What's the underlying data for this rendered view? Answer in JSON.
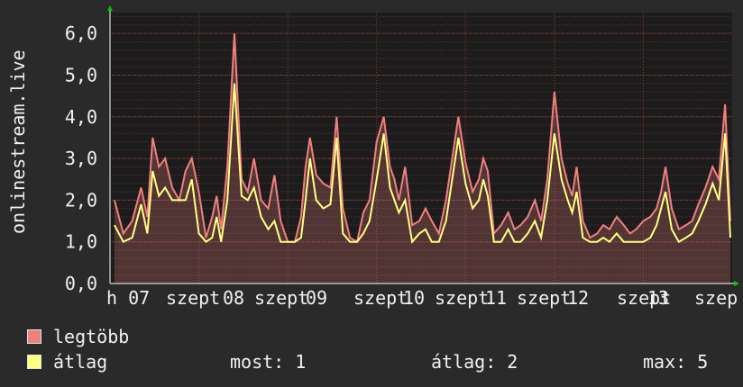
{
  "chart_data": {
    "type": "area",
    "ylabel": "onlinestream.live",
    "ylim": [
      0,
      6.5
    ],
    "yticks": [
      "0,0",
      "1,0",
      "2,0",
      "3,0",
      "4,0",
      "5,0",
      "6,0"
    ],
    "ytick_values": [
      0,
      1,
      2,
      3,
      4,
      5,
      6
    ],
    "xticks": [
      "h 07",
      "szept",
      "08",
      "szept",
      "09",
      "szept",
      "10",
      "szept",
      "11",
      "szept",
      "12",
      "szept",
      "13",
      "szep"
    ],
    "xlim": [
      0,
      7
    ],
    "grid": true,
    "series": [
      {
        "name": "legtöbb",
        "color": "#f07f7f",
        "x": [
          0.05,
          0.15,
          0.25,
          0.35,
          0.42,
          0.48,
          0.55,
          0.62,
          0.7,
          0.78,
          0.85,
          0.92,
          1.0,
          1.08,
          1.15,
          1.2,
          1.25,
          1.32,
          1.4,
          1.48,
          1.55,
          1.62,
          1.7,
          1.78,
          1.85,
          1.92,
          2.0,
          2.08,
          2.15,
          2.2,
          2.25,
          2.32,
          2.4,
          2.48,
          2.55,
          2.62,
          2.7,
          2.78,
          2.85,
          2.92,
          3.0,
          3.08,
          3.15,
          3.2,
          3.25,
          3.32,
          3.4,
          3.48,
          3.55,
          3.62,
          3.7,
          3.78,
          3.85,
          3.92,
          4.0,
          4.08,
          4.15,
          4.2,
          4.25,
          4.32,
          4.4,
          4.48,
          4.55,
          4.62,
          4.7,
          4.78,
          4.85,
          4.92,
          5.0,
          5.08,
          5.15,
          5.2,
          5.25,
          5.32,
          5.4,
          5.48,
          5.55,
          5.62,
          5.7,
          5.78,
          5.85,
          5.92,
          6.0,
          6.08,
          6.15,
          6.2,
          6.25,
          6.32,
          6.4,
          6.48,
          6.55,
          6.62,
          6.7,
          6.78,
          6.85,
          6.92,
          6.98
        ],
        "values": [
          2.0,
          1.2,
          1.5,
          2.3,
          1.6,
          3.5,
          2.8,
          3.0,
          2.3,
          2.0,
          2.7,
          3.0,
          2.2,
          1.1,
          1.6,
          2.1,
          1.3,
          2.8,
          6.0,
          2.5,
          2.2,
          3.0,
          2.0,
          1.8,
          2.6,
          1.5,
          1.0,
          1.0,
          1.6,
          2.8,
          3.5,
          2.6,
          2.4,
          2.3,
          4.0,
          1.8,
          1.1,
          1.0,
          1.7,
          2.0,
          3.4,
          4.0,
          2.8,
          2.5,
          2.0,
          2.8,
          1.4,
          1.5,
          1.8,
          1.5,
          1.2,
          2.0,
          3.0,
          4.0,
          2.9,
          2.2,
          2.5,
          3.0,
          2.7,
          1.2,
          1.4,
          1.7,
          1.3,
          1.4,
          1.6,
          2.0,
          1.5,
          2.5,
          4.6,
          3.0,
          2.4,
          2.1,
          2.8,
          1.5,
          1.1,
          1.2,
          1.4,
          1.3,
          1.6,
          1.4,
          1.2,
          1.3,
          1.5,
          1.6,
          1.8,
          2.2,
          2.8,
          1.8,
          1.3,
          1.4,
          1.5,
          1.9,
          2.3,
          2.8,
          2.5,
          4.3,
          1.5
        ]
      },
      {
        "name": "átlag",
        "color": "#ffff80",
        "x": [
          0.05,
          0.15,
          0.25,
          0.35,
          0.42,
          0.48,
          0.55,
          0.62,
          0.7,
          0.78,
          0.85,
          0.92,
          1.0,
          1.08,
          1.15,
          1.2,
          1.25,
          1.32,
          1.4,
          1.48,
          1.55,
          1.62,
          1.7,
          1.78,
          1.85,
          1.92,
          2.0,
          2.08,
          2.15,
          2.2,
          2.25,
          2.32,
          2.4,
          2.48,
          2.55,
          2.62,
          2.7,
          2.78,
          2.85,
          2.92,
          3.0,
          3.08,
          3.15,
          3.2,
          3.25,
          3.32,
          3.4,
          3.48,
          3.55,
          3.62,
          3.7,
          3.78,
          3.85,
          3.92,
          4.0,
          4.08,
          4.15,
          4.2,
          4.25,
          4.32,
          4.4,
          4.48,
          4.55,
          4.62,
          4.7,
          4.78,
          4.85,
          4.92,
          5.0,
          5.08,
          5.15,
          5.2,
          5.25,
          5.32,
          5.4,
          5.48,
          5.55,
          5.62,
          5.7,
          5.78,
          5.85,
          5.92,
          6.0,
          6.08,
          6.15,
          6.2,
          6.25,
          6.32,
          6.4,
          6.48,
          6.55,
          6.62,
          6.7,
          6.78,
          6.85,
          6.92,
          6.98
        ],
        "values": [
          1.4,
          1.0,
          1.1,
          1.9,
          1.2,
          2.7,
          2.1,
          2.3,
          2.0,
          2.0,
          2.0,
          2.5,
          1.2,
          1.0,
          1.1,
          1.6,
          1.0,
          2.0,
          4.8,
          2.1,
          2.0,
          2.3,
          1.6,
          1.3,
          1.5,
          1.0,
          1.0,
          1.0,
          1.1,
          2.0,
          3.0,
          2.0,
          1.8,
          1.9,
          3.5,
          1.2,
          1.0,
          1.0,
          1.2,
          1.5,
          2.5,
          3.6,
          2.3,
          2.0,
          1.7,
          2.0,
          1.0,
          1.2,
          1.3,
          1.0,
          1.0,
          1.5,
          2.5,
          3.5,
          2.4,
          1.8,
          2.0,
          2.5,
          2.1,
          1.0,
          1.0,
          1.3,
          1.0,
          1.0,
          1.2,
          1.5,
          1.1,
          2.0,
          3.6,
          2.5,
          2.0,
          1.7,
          2.2,
          1.1,
          1.0,
          1.0,
          1.1,
          1.0,
          1.2,
          1.0,
          1.0,
          1.0,
          1.0,
          1.1,
          1.4,
          1.8,
          2.2,
          1.3,
          1.0,
          1.1,
          1.2,
          1.5,
          1.9,
          2.4,
          2.0,
          3.6,
          1.1
        ]
      }
    ]
  },
  "legend": {
    "max_label": "legtöbb",
    "avg_label": "átlag"
  },
  "stats": {
    "now": "most: 1",
    "avg": "átlag: 2",
    "max": "max: 5"
  },
  "colors": {
    "background": "#2a2a2a",
    "plot_bg": "#1c1c1c",
    "grid": "#6e3434",
    "axis": "#ffffff",
    "arrow": "#00cc00"
  }
}
